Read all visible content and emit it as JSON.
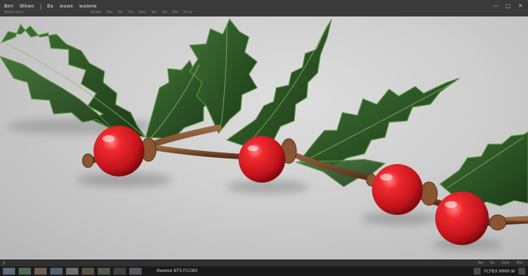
{
  "window": {
    "menu": [
      "Ben",
      "Wkwo",
      "Ba",
      "waws",
      "wawew"
    ],
    "subline": "Bwwt wam",
    "tools": [
      "Wcwe",
      "Ww",
      "Be",
      "Sw",
      "Bwo",
      "Wc",
      "Aw",
      "Bw",
      "Sccw"
    ],
    "controls": [
      "—",
      "□",
      "✕"
    ]
  },
  "canvas": {
    "subject": "holly-branch-image",
    "colors": {
      "background": "#cfcfcf",
      "leaf": "#2f5a27",
      "berry": "#d81f26",
      "stem": "#7a4a2a"
    }
  },
  "statusbar": {
    "left": "2",
    "right": [
      "Bw",
      "Bu",
      "Sww",
      "Ww"
    ]
  },
  "taskbar": {
    "label": "Bwwwa NTS FCCNO",
    "tray_text": "FCPBX MMM W"
  }
}
